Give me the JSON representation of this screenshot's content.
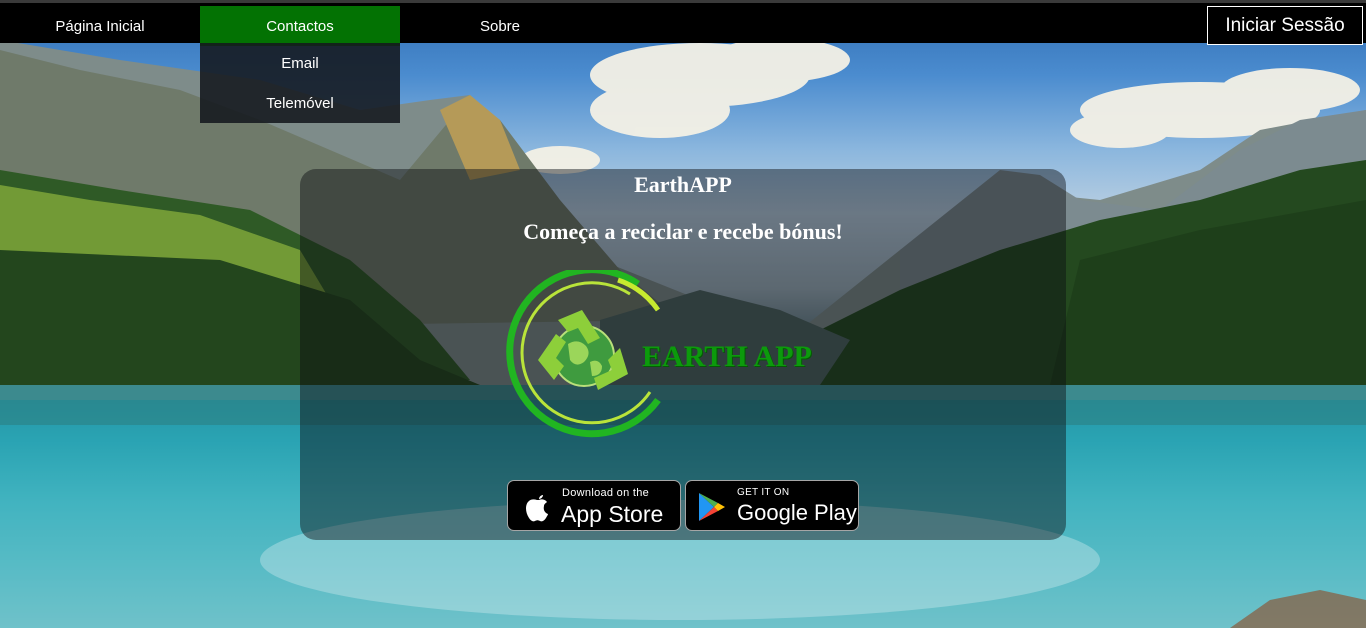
{
  "nav": {
    "home_label": "Página Inicial",
    "contacts_label": "Contactos",
    "about_label": "Sobre",
    "login_label": "Iniciar Sessão"
  },
  "dropdown": {
    "items": [
      "Email",
      "Telemóvel"
    ]
  },
  "panel": {
    "title": "EarthAPP",
    "subtitle": "Começa a reciclar e recebe bónus!",
    "logo_text": "EARTH APP",
    "logo_icon": "recycle-globe-icon"
  },
  "stores": {
    "apple": {
      "small": "Download on the",
      "big": "App Store",
      "icon": "apple-icon"
    },
    "google": {
      "small": "GET IT ON",
      "big": "Google Play",
      "icon": "google-play-icon"
    }
  },
  "colors": {
    "nav_active": "#037203",
    "logo_green": "#0c9a0c",
    "topbar": "#000000"
  }
}
